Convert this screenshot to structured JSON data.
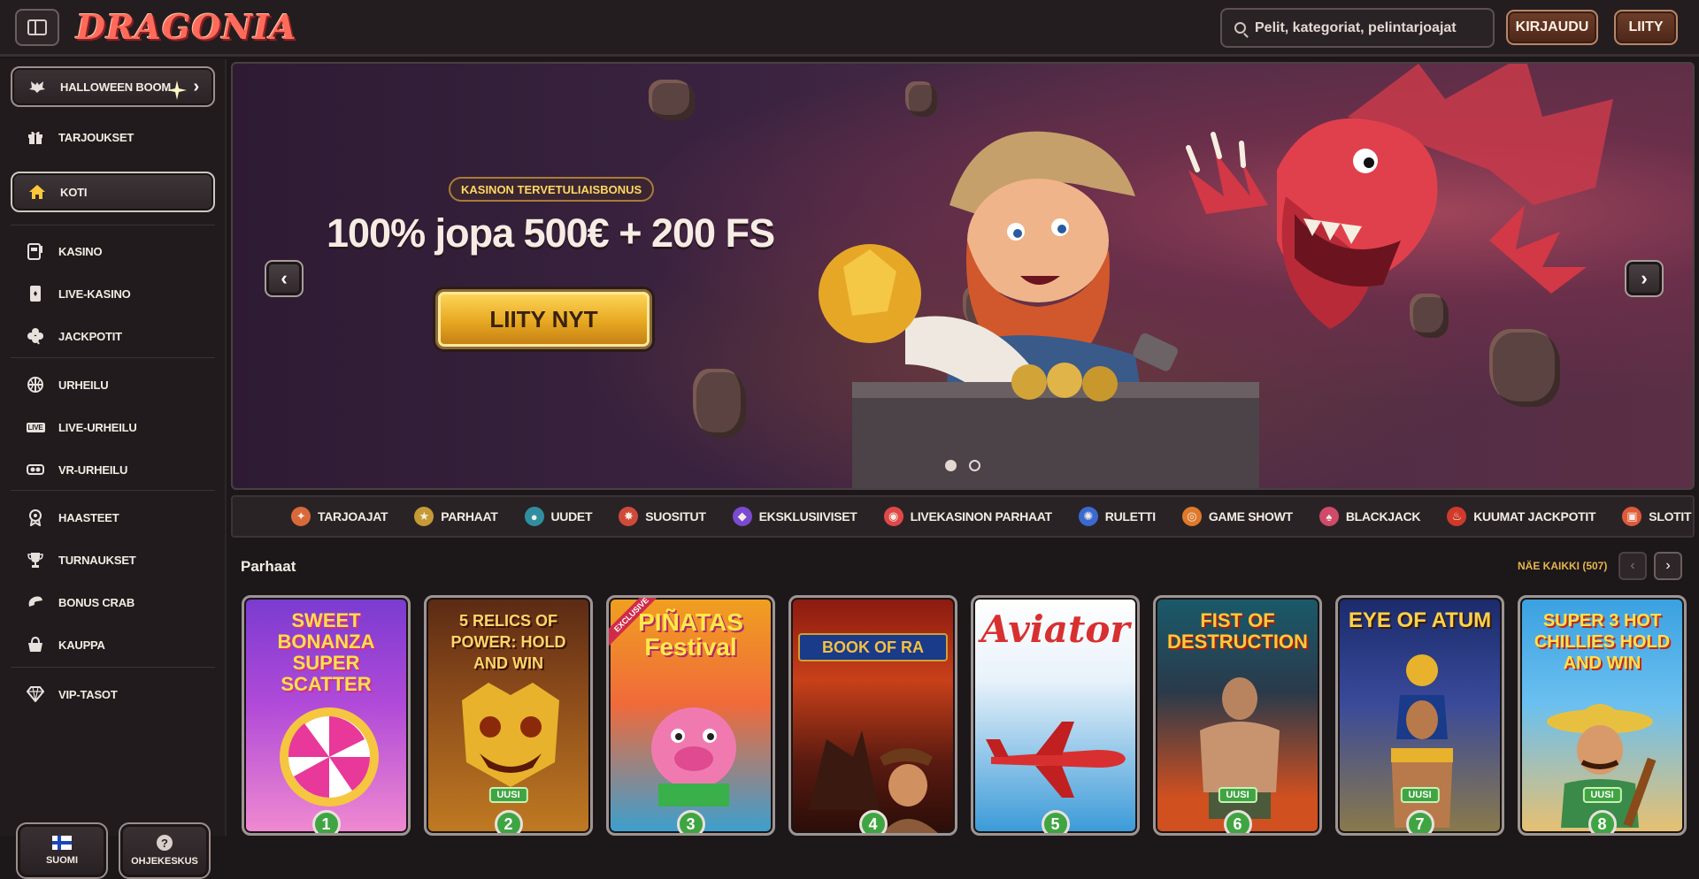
{
  "header": {
    "logo": "DRAGONIA",
    "search_placeholder": "Pelit, kategoriat, pelintarjoajat",
    "login_label": "KIRJAUDU",
    "join_label": "LIITY"
  },
  "sidebar": {
    "promo": "HALLOWEEN BOOM",
    "items": [
      {
        "label": "TARJOUKSET",
        "icon": "gift-icon"
      },
      {
        "label": "KOTI",
        "icon": "home-icon"
      },
      {
        "label": "KASINO",
        "icon": "slot-machine-icon"
      },
      {
        "label": "LIVE-KASINO",
        "icon": "cards-icon"
      },
      {
        "label": "JACKPOTIT",
        "icon": "clover-icon"
      },
      {
        "label": "URHEILU",
        "icon": "basketball-icon"
      },
      {
        "label": "LIVE-URHEILU",
        "icon": "live-icon"
      },
      {
        "label": "VR-URHEILU",
        "icon": "vr-icon"
      },
      {
        "label": "HAASTEET",
        "icon": "medal-icon"
      },
      {
        "label": "TURNAUKSET",
        "icon": "trophy-icon"
      },
      {
        "label": "BONUS CRAB",
        "icon": "crab-claw-icon"
      },
      {
        "label": "KAUPPA",
        "icon": "basket-icon"
      },
      {
        "label": "VIP-TASOT",
        "icon": "diamond-icon"
      }
    ],
    "live_tag": "LIVE",
    "language_label": "SUOMI",
    "help_label": "OHJEKESKUS",
    "help_glyph": "?"
  },
  "hero": {
    "badge": "KASINON TERVETULIAISBONUS",
    "headline": "100% jopa 500€ + 200 FS",
    "cta": "LIITY NYT",
    "prev_glyph": "‹",
    "next_glyph": "›",
    "slides": 2,
    "active_slide": 1
  },
  "categories": [
    {
      "label": "TARJOAJAT",
      "color": "#d8693a",
      "glyph": "✦"
    },
    {
      "label": "PARHAAT",
      "color": "#c59a35",
      "glyph": "★"
    },
    {
      "label": "UUDET",
      "color": "#2f8fa0",
      "glyph": "●"
    },
    {
      "label": "SUOSITUT",
      "color": "#d04a3a",
      "glyph": "✸"
    },
    {
      "label": "EKSKLUSIIVISET",
      "color": "#7a4ad0",
      "glyph": "◆"
    },
    {
      "label": "LIVEKASINON PARHAAT",
      "color": "#e04848",
      "glyph": "◉"
    },
    {
      "label": "RULETTI",
      "color": "#3a6ad0",
      "glyph": "✺"
    },
    {
      "label": "GAME SHOWT",
      "color": "#e07a2a",
      "glyph": "◎"
    },
    {
      "label": "BLACKJACK",
      "color": "#d04a6a",
      "glyph": "♠"
    },
    {
      "label": "KUUMAT JACKPOTIT",
      "color": "#d03a2a",
      "glyph": "♨"
    },
    {
      "label": "SLOTIT",
      "color": "#e05a3a",
      "glyph": "▣"
    }
  ],
  "section": {
    "title": "Parhaat",
    "see_all": "NÄE KAIKKI (507)",
    "prev_glyph": "‹",
    "next_glyph": "›"
  },
  "games": [
    {
      "title": "SWEET BONANZA SUPER SCATTER",
      "rank": "1",
      "tag": ""
    },
    {
      "title": "5 RELICS OF POWER: HOLD AND WIN",
      "rank": "2",
      "tag": "UUSI"
    },
    {
      "title": "PIÑATAS Festival",
      "rank": "3",
      "tag": "",
      "exclusive": "EXCLUSIVE"
    },
    {
      "title": "BOOK OF RA",
      "rank": "4",
      "tag": ""
    },
    {
      "title": "Aviator",
      "rank": "5",
      "tag": ""
    },
    {
      "title": "FIST OF DESTRUCTION",
      "rank": "6",
      "tag": "UUSI"
    },
    {
      "title": "EYE OF ATUM",
      "rank": "7",
      "tag": "UUSI"
    },
    {
      "title": "SUPER 3 HOT CHILLIES HOLD AND WIN",
      "rank": "8",
      "tag": "UUSI"
    }
  ]
}
